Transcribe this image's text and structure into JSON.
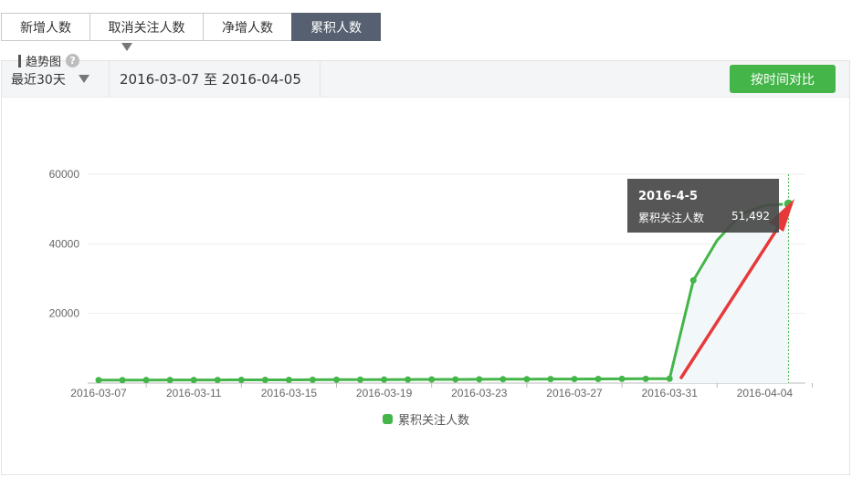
{
  "tabs": [
    {
      "label": "新增人数",
      "active": false
    },
    {
      "label": "取消关注人数",
      "active": false
    },
    {
      "label": "净增人数",
      "active": false
    },
    {
      "label": "累积人数",
      "active": true
    }
  ],
  "toolbar": {
    "range_label": "最近30天",
    "date_range": "2016-03-07 至 2016-04-05",
    "compare_button": "按时间对比"
  },
  "trend": {
    "title": "趋势图",
    "help_icon": "question-mark-icon"
  },
  "tooltip": {
    "date": "2016-4-5",
    "series_label": "累积关注人数",
    "value": "51,492"
  },
  "colors": {
    "line": "#44b549",
    "active_tab": "#566070",
    "arrow": "#e8393a",
    "tooltip_bg": "#484848"
  },
  "chart_data": {
    "type": "line",
    "title": "",
    "xlabel": "",
    "ylabel": "",
    "ylim": [
      0,
      60000
    ],
    "yticks": [
      "60000",
      "40000",
      "20000"
    ],
    "x_tick_labels": [
      "2016-03-07",
      "2016-03-11",
      "2016-03-15",
      "2016-03-19",
      "2016-03-23",
      "2016-03-27",
      "2016-03-31",
      "2016-04-04"
    ],
    "x_tick_every": 4,
    "grid": true,
    "legend": "bottom-center",
    "series": [
      {
        "name": "累积关注人数",
        "x": [
          "2016-03-07",
          "2016-03-08",
          "2016-03-09",
          "2016-03-10",
          "2016-03-11",
          "2016-03-12",
          "2016-03-13",
          "2016-03-14",
          "2016-03-15",
          "2016-03-16",
          "2016-03-17",
          "2016-03-18",
          "2016-03-19",
          "2016-03-20",
          "2016-03-21",
          "2016-03-22",
          "2016-03-23",
          "2016-03-24",
          "2016-03-25",
          "2016-03-26",
          "2016-03-27",
          "2016-03-28",
          "2016-03-29",
          "2016-03-30",
          "2016-03-31",
          "2016-04-01",
          "2016-04-02",
          "2016-04-03",
          "2016-04-04",
          "2016-04-05"
        ],
        "values": [
          850,
          860,
          870,
          880,
          890,
          900,
          910,
          915,
          920,
          940,
          960,
          980,
          1000,
          1020,
          1040,
          1060,
          1080,
          1100,
          1120,
          1140,
          1160,
          1180,
          1200,
          1220,
          1240,
          29500,
          41000,
          48500,
          51000,
          51492
        ]
      }
    ]
  }
}
